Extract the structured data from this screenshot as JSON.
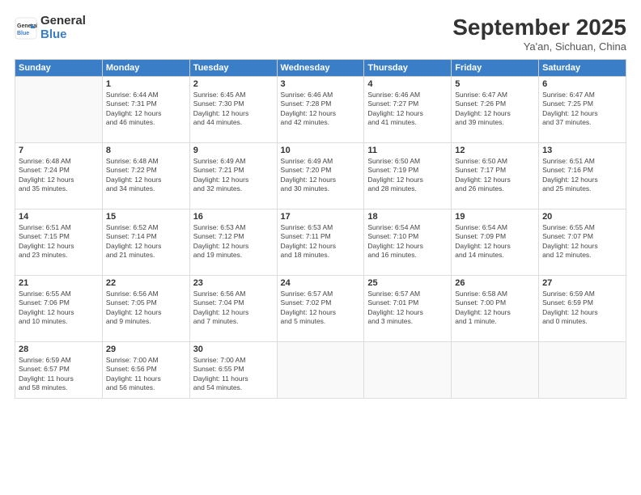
{
  "logo": {
    "general": "General",
    "blue": "Blue"
  },
  "header": {
    "month": "September 2025",
    "location": "Ya'an, Sichuan, China"
  },
  "days_of_week": [
    "Sunday",
    "Monday",
    "Tuesday",
    "Wednesday",
    "Thursday",
    "Friday",
    "Saturday"
  ],
  "weeks": [
    [
      {
        "day": "",
        "info": ""
      },
      {
        "day": "1",
        "info": "Sunrise: 6:44 AM\nSunset: 7:31 PM\nDaylight: 12 hours\nand 46 minutes."
      },
      {
        "day": "2",
        "info": "Sunrise: 6:45 AM\nSunset: 7:30 PM\nDaylight: 12 hours\nand 44 minutes."
      },
      {
        "day": "3",
        "info": "Sunrise: 6:46 AM\nSunset: 7:28 PM\nDaylight: 12 hours\nand 42 minutes."
      },
      {
        "day": "4",
        "info": "Sunrise: 6:46 AM\nSunset: 7:27 PM\nDaylight: 12 hours\nand 41 minutes."
      },
      {
        "day": "5",
        "info": "Sunrise: 6:47 AM\nSunset: 7:26 PM\nDaylight: 12 hours\nand 39 minutes."
      },
      {
        "day": "6",
        "info": "Sunrise: 6:47 AM\nSunset: 7:25 PM\nDaylight: 12 hours\nand 37 minutes."
      }
    ],
    [
      {
        "day": "7",
        "info": "Sunrise: 6:48 AM\nSunset: 7:24 PM\nDaylight: 12 hours\nand 35 minutes."
      },
      {
        "day": "8",
        "info": "Sunrise: 6:48 AM\nSunset: 7:22 PM\nDaylight: 12 hours\nand 34 minutes."
      },
      {
        "day": "9",
        "info": "Sunrise: 6:49 AM\nSunset: 7:21 PM\nDaylight: 12 hours\nand 32 minutes."
      },
      {
        "day": "10",
        "info": "Sunrise: 6:49 AM\nSunset: 7:20 PM\nDaylight: 12 hours\nand 30 minutes."
      },
      {
        "day": "11",
        "info": "Sunrise: 6:50 AM\nSunset: 7:19 PM\nDaylight: 12 hours\nand 28 minutes."
      },
      {
        "day": "12",
        "info": "Sunrise: 6:50 AM\nSunset: 7:17 PM\nDaylight: 12 hours\nand 26 minutes."
      },
      {
        "day": "13",
        "info": "Sunrise: 6:51 AM\nSunset: 7:16 PM\nDaylight: 12 hours\nand 25 minutes."
      }
    ],
    [
      {
        "day": "14",
        "info": "Sunrise: 6:51 AM\nSunset: 7:15 PM\nDaylight: 12 hours\nand 23 minutes."
      },
      {
        "day": "15",
        "info": "Sunrise: 6:52 AM\nSunset: 7:14 PM\nDaylight: 12 hours\nand 21 minutes."
      },
      {
        "day": "16",
        "info": "Sunrise: 6:53 AM\nSunset: 7:12 PM\nDaylight: 12 hours\nand 19 minutes."
      },
      {
        "day": "17",
        "info": "Sunrise: 6:53 AM\nSunset: 7:11 PM\nDaylight: 12 hours\nand 18 minutes."
      },
      {
        "day": "18",
        "info": "Sunrise: 6:54 AM\nSunset: 7:10 PM\nDaylight: 12 hours\nand 16 minutes."
      },
      {
        "day": "19",
        "info": "Sunrise: 6:54 AM\nSunset: 7:09 PM\nDaylight: 12 hours\nand 14 minutes."
      },
      {
        "day": "20",
        "info": "Sunrise: 6:55 AM\nSunset: 7:07 PM\nDaylight: 12 hours\nand 12 minutes."
      }
    ],
    [
      {
        "day": "21",
        "info": "Sunrise: 6:55 AM\nSunset: 7:06 PM\nDaylight: 12 hours\nand 10 minutes."
      },
      {
        "day": "22",
        "info": "Sunrise: 6:56 AM\nSunset: 7:05 PM\nDaylight: 12 hours\nand 9 minutes."
      },
      {
        "day": "23",
        "info": "Sunrise: 6:56 AM\nSunset: 7:04 PM\nDaylight: 12 hours\nand 7 minutes."
      },
      {
        "day": "24",
        "info": "Sunrise: 6:57 AM\nSunset: 7:02 PM\nDaylight: 12 hours\nand 5 minutes."
      },
      {
        "day": "25",
        "info": "Sunrise: 6:57 AM\nSunset: 7:01 PM\nDaylight: 12 hours\nand 3 minutes."
      },
      {
        "day": "26",
        "info": "Sunrise: 6:58 AM\nSunset: 7:00 PM\nDaylight: 12 hours\nand 1 minute."
      },
      {
        "day": "27",
        "info": "Sunrise: 6:59 AM\nSunset: 6:59 PM\nDaylight: 12 hours\nand 0 minutes."
      }
    ],
    [
      {
        "day": "28",
        "info": "Sunrise: 6:59 AM\nSunset: 6:57 PM\nDaylight: 11 hours\nand 58 minutes."
      },
      {
        "day": "29",
        "info": "Sunrise: 7:00 AM\nSunset: 6:56 PM\nDaylight: 11 hours\nand 56 minutes."
      },
      {
        "day": "30",
        "info": "Sunrise: 7:00 AM\nSunset: 6:55 PM\nDaylight: 11 hours\nand 54 minutes."
      },
      {
        "day": "",
        "info": ""
      },
      {
        "day": "",
        "info": ""
      },
      {
        "day": "",
        "info": ""
      },
      {
        "day": "",
        "info": ""
      }
    ]
  ]
}
